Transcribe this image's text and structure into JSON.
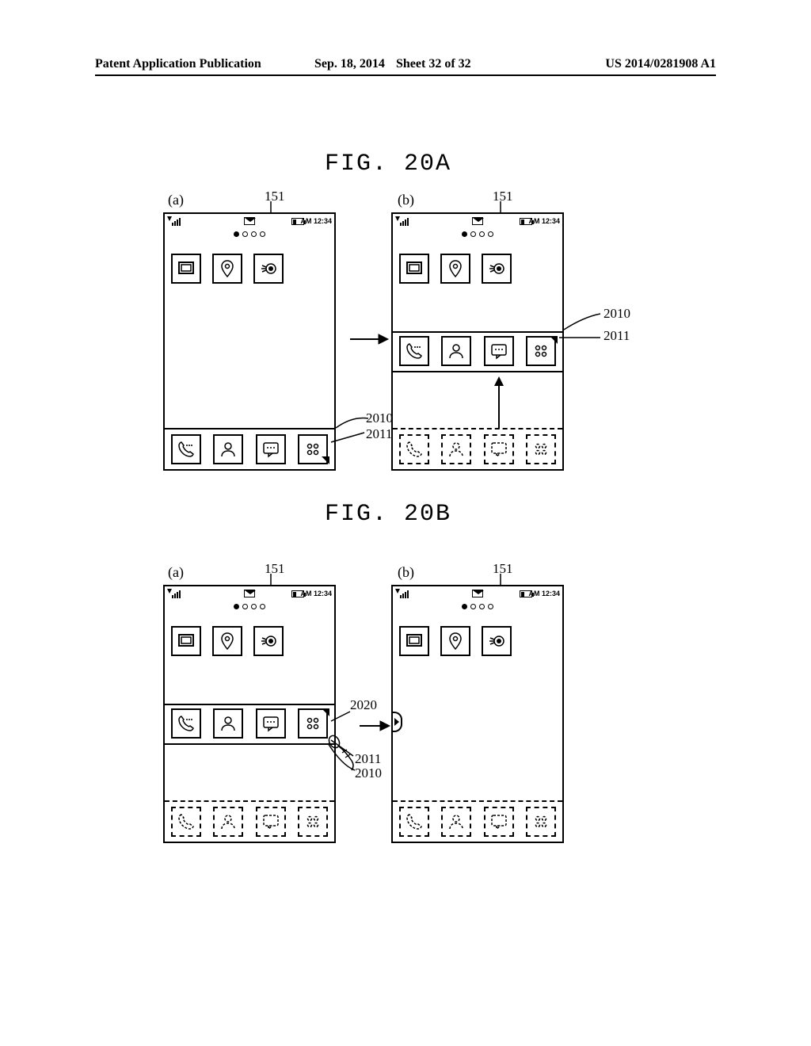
{
  "header": {
    "publication": "Patent Application Publication",
    "date": "Sep. 18, 2014",
    "sheet": "Sheet 32 of 32",
    "number": "US 2014/0281908 A1"
  },
  "figures": {
    "a": {
      "caption": "FIG. 20A",
      "sub_a": "(a)",
      "sub_b": "(b)",
      "ref151": "151"
    },
    "b": {
      "caption": "FIG. 20B",
      "sub_a": "(a)",
      "sub_b": "(b)",
      "ref151": "151"
    }
  },
  "status": {
    "time": "AM 12:34"
  },
  "refs": {
    "r2010": "2010",
    "r2011": "2011",
    "r2020": "2020"
  }
}
